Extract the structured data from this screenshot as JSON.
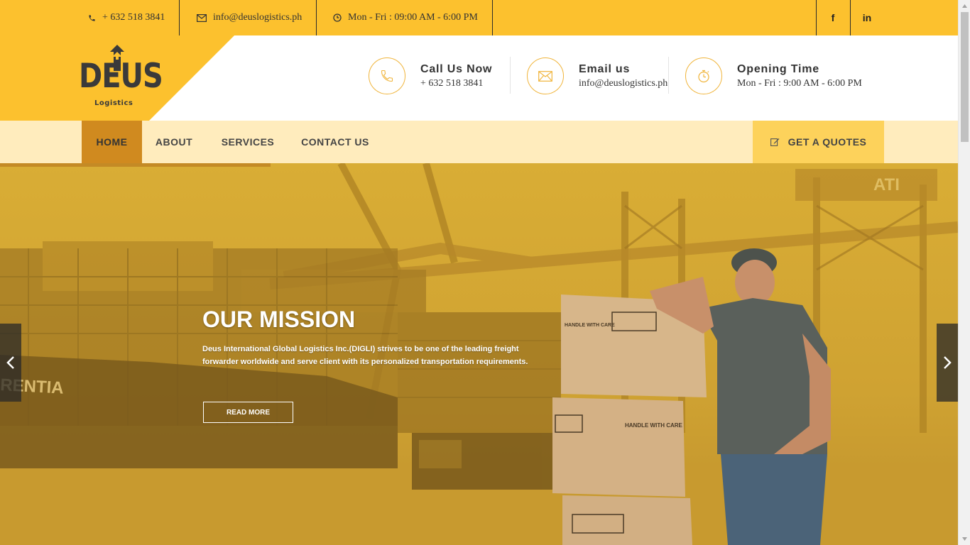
{
  "topbar": {
    "phone": "+ 632 518 3841",
    "email": "info@deuslogistics.ph",
    "hours": "Mon - Fri : 09:00 AM - 6:00 PM",
    "social": [
      {
        "label": "f",
        "icon": "facebook-icon"
      },
      {
        "label": "in",
        "icon": "linkedin-icon"
      }
    ]
  },
  "logo": {
    "name": "DEUS",
    "sub": "Logistics"
  },
  "header": {
    "call": {
      "title": "Call Us Now",
      "value": "+ 632 518 3841",
      "icon": "phone-icon"
    },
    "email": {
      "title": "Email us",
      "value": "info@deuslogistics.ph",
      "icon": "envelope-icon"
    },
    "opening": {
      "title": "Opening Time",
      "value": "Mon - Fri : 9:00 AM - 6:00 PM",
      "icon": "stopwatch-icon"
    }
  },
  "nav": {
    "items": [
      {
        "label": "HOME",
        "active": true
      },
      {
        "label": "ABOUT",
        "active": false
      },
      {
        "label": "SERVICES",
        "active": false
      },
      {
        "label": "CONTACT US",
        "active": false
      }
    ],
    "quote_label": "GET A QUOTES",
    "quote_icon": "edit-icon"
  },
  "hero": {
    "title": "OUR MISSION",
    "text": "Deus International Global Logistics Inc.(DIGLI) strives to be one of the leading freight forwarder worldwide and serve client with its personalized transportation requirements.",
    "button": "READ MORE",
    "box_label": "HANDLE WITH CARE",
    "ship_text": "RENTIA",
    "crane_text": "ATI"
  },
  "colors": {
    "topbar": "#fcc12e",
    "nav_bg": "#ffecbd",
    "nav_active": "#d08a1f",
    "quote_bg": "#fdd25b",
    "hero_tint": "#d4a62e"
  }
}
